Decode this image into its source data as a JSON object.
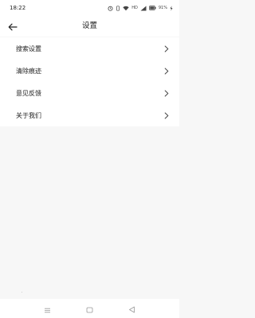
{
  "status_bar": {
    "time": "18:22",
    "network_label": "HD",
    "battery_text": "91%",
    "icons": [
      "alarm-icon",
      "vibrate-icon",
      "wifi-icon",
      "hd-icon",
      "signal-icon",
      "battery-icon",
      "charging-icon"
    ]
  },
  "header": {
    "title": "设置",
    "back_icon": "arrow-left-icon"
  },
  "menu": {
    "items": [
      {
        "label": "搜索设置",
        "icon": "chevron-right-icon"
      },
      {
        "label": "清除痕迹",
        "icon": "chevron-right-icon"
      },
      {
        "label": "意见反馈",
        "icon": "chevron-right-icon"
      },
      {
        "label": "关于我们",
        "icon": "chevron-right-icon"
      }
    ]
  },
  "nav_bar": {
    "icons": [
      "menu-icon",
      "home-square-icon",
      "back-triangle-icon"
    ]
  }
}
